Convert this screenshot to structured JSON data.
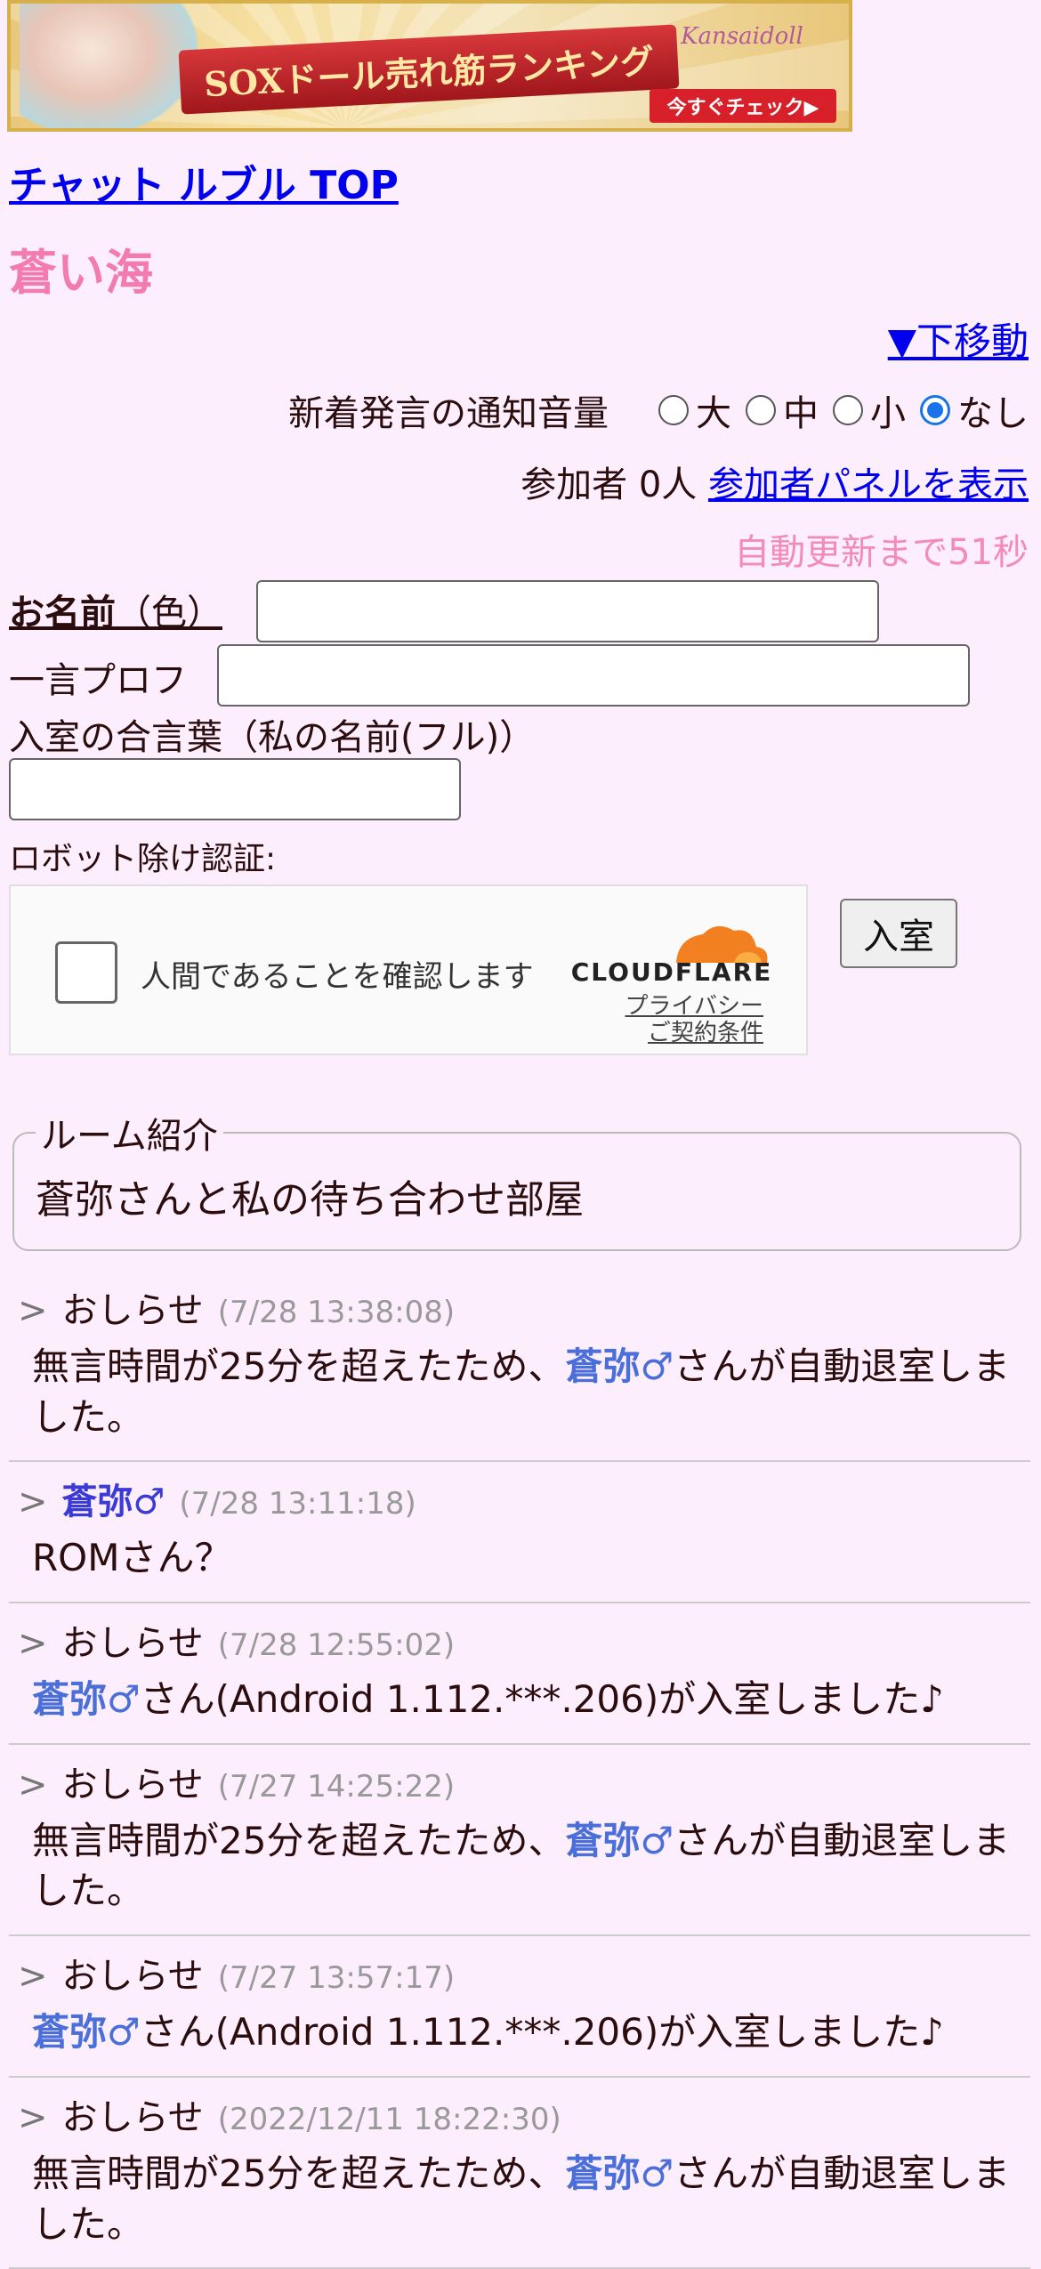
{
  "banner": {
    "ribbon_text": "SOXドール売れ筋ランキング",
    "brand_text": "Kansaidoll",
    "check_label": "今すぐチェック▶"
  },
  "header": {
    "top_link": "チャット ルブル TOP",
    "room_title": "蒼い海",
    "move_down": "▼下移動"
  },
  "notify": {
    "label": "新着発言の通知音量",
    "options": [
      "大",
      "中",
      "小",
      "なし"
    ],
    "selected": "なし"
  },
  "participants": {
    "label": "参加者 0人",
    "panel_link": "参加者パネルを表示"
  },
  "countdown": "自動更新まで51秒",
  "form": {
    "name_label": "お名前",
    "name_color_label": "（色）",
    "name_value": "",
    "profile_label": "一言プロフ",
    "profile_value": "",
    "password_label": "入室の合言葉（私の名前(フル)）",
    "password_value": "",
    "robot_label": "ロボット除け認証:",
    "turnstile_text": "人間であることを確認します",
    "cf_name": "CLOUDFLARE",
    "cf_privacy": "プライバシー",
    "cf_terms": "ご契約条件",
    "enter_button": "入室"
  },
  "intro": {
    "legend": "ルーム紹介",
    "body": "蒼弥さんと私の待ち合わせ部屋"
  },
  "messages": [
    {
      "sender": "おしらせ",
      "is_user": false,
      "time": "(7/28 13:38:08)",
      "pre": "無言時間が25分を超えたため、",
      "uname": "蒼弥♂",
      "post": "さんが自動退室しました。"
    },
    {
      "sender": "蒼弥♂",
      "is_user": true,
      "time": "(7/28 13:11:18)",
      "pre": "ROMさん？",
      "uname": "",
      "post": ""
    },
    {
      "sender": "おしらせ",
      "is_user": false,
      "time": "(7/28 12:55:02)",
      "pre": "",
      "uname": "蒼弥♂",
      "post": "さん(Android 1.112.***.206)が入室しました♪"
    },
    {
      "sender": "おしらせ",
      "is_user": false,
      "time": "(7/27 14:25:22)",
      "pre": "無言時間が25分を超えたため、",
      "uname": "蒼弥♂",
      "post": "さんが自動退室しました。"
    },
    {
      "sender": "おしらせ",
      "is_user": false,
      "time": "(7/27 13:57:17)",
      "pre": "",
      "uname": "蒼弥♂",
      "post": "さん(Android 1.112.***.206)が入室しました♪"
    },
    {
      "sender": "おしらせ",
      "is_user": false,
      "time": "(2022/12/11 18:22:30)",
      "pre": "無言時間が25分を超えたため、",
      "uname": "蒼弥♂",
      "post": "さんが自動退室しました。"
    }
  ]
}
